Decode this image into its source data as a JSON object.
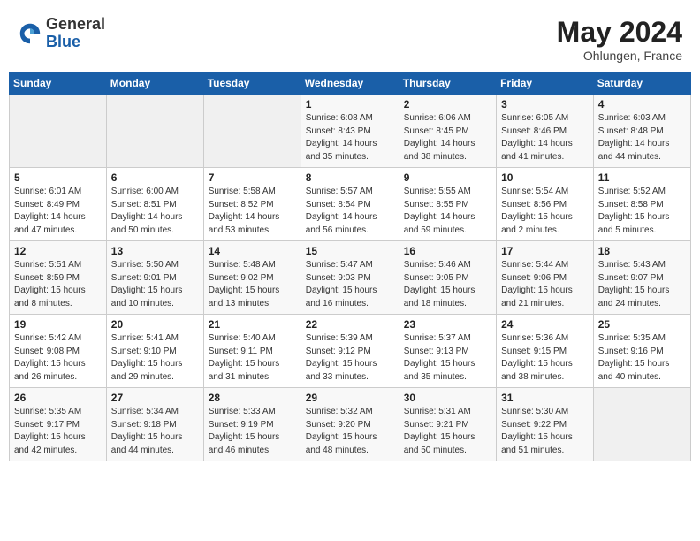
{
  "header": {
    "logo_general": "General",
    "logo_blue": "Blue",
    "month_year": "May 2024",
    "location": "Ohlungen, France"
  },
  "weekdays": [
    "Sunday",
    "Monday",
    "Tuesday",
    "Wednesday",
    "Thursday",
    "Friday",
    "Saturday"
  ],
  "weeks": [
    [
      {
        "day": "",
        "info": ""
      },
      {
        "day": "",
        "info": ""
      },
      {
        "day": "",
        "info": ""
      },
      {
        "day": "1",
        "info": "Sunrise: 6:08 AM\nSunset: 8:43 PM\nDaylight: 14 hours\nand 35 minutes."
      },
      {
        "day": "2",
        "info": "Sunrise: 6:06 AM\nSunset: 8:45 PM\nDaylight: 14 hours\nand 38 minutes."
      },
      {
        "day": "3",
        "info": "Sunrise: 6:05 AM\nSunset: 8:46 PM\nDaylight: 14 hours\nand 41 minutes."
      },
      {
        "day": "4",
        "info": "Sunrise: 6:03 AM\nSunset: 8:48 PM\nDaylight: 14 hours\nand 44 minutes."
      }
    ],
    [
      {
        "day": "5",
        "info": "Sunrise: 6:01 AM\nSunset: 8:49 PM\nDaylight: 14 hours\nand 47 minutes."
      },
      {
        "day": "6",
        "info": "Sunrise: 6:00 AM\nSunset: 8:51 PM\nDaylight: 14 hours\nand 50 minutes."
      },
      {
        "day": "7",
        "info": "Sunrise: 5:58 AM\nSunset: 8:52 PM\nDaylight: 14 hours\nand 53 minutes."
      },
      {
        "day": "8",
        "info": "Sunrise: 5:57 AM\nSunset: 8:54 PM\nDaylight: 14 hours\nand 56 minutes."
      },
      {
        "day": "9",
        "info": "Sunrise: 5:55 AM\nSunset: 8:55 PM\nDaylight: 14 hours\nand 59 minutes."
      },
      {
        "day": "10",
        "info": "Sunrise: 5:54 AM\nSunset: 8:56 PM\nDaylight: 15 hours\nand 2 minutes."
      },
      {
        "day": "11",
        "info": "Sunrise: 5:52 AM\nSunset: 8:58 PM\nDaylight: 15 hours\nand 5 minutes."
      }
    ],
    [
      {
        "day": "12",
        "info": "Sunrise: 5:51 AM\nSunset: 8:59 PM\nDaylight: 15 hours\nand 8 minutes."
      },
      {
        "day": "13",
        "info": "Sunrise: 5:50 AM\nSunset: 9:01 PM\nDaylight: 15 hours\nand 10 minutes."
      },
      {
        "day": "14",
        "info": "Sunrise: 5:48 AM\nSunset: 9:02 PM\nDaylight: 15 hours\nand 13 minutes."
      },
      {
        "day": "15",
        "info": "Sunrise: 5:47 AM\nSunset: 9:03 PM\nDaylight: 15 hours\nand 16 minutes."
      },
      {
        "day": "16",
        "info": "Sunrise: 5:46 AM\nSunset: 9:05 PM\nDaylight: 15 hours\nand 18 minutes."
      },
      {
        "day": "17",
        "info": "Sunrise: 5:44 AM\nSunset: 9:06 PM\nDaylight: 15 hours\nand 21 minutes."
      },
      {
        "day": "18",
        "info": "Sunrise: 5:43 AM\nSunset: 9:07 PM\nDaylight: 15 hours\nand 24 minutes."
      }
    ],
    [
      {
        "day": "19",
        "info": "Sunrise: 5:42 AM\nSunset: 9:08 PM\nDaylight: 15 hours\nand 26 minutes."
      },
      {
        "day": "20",
        "info": "Sunrise: 5:41 AM\nSunset: 9:10 PM\nDaylight: 15 hours\nand 29 minutes."
      },
      {
        "day": "21",
        "info": "Sunrise: 5:40 AM\nSunset: 9:11 PM\nDaylight: 15 hours\nand 31 minutes."
      },
      {
        "day": "22",
        "info": "Sunrise: 5:39 AM\nSunset: 9:12 PM\nDaylight: 15 hours\nand 33 minutes."
      },
      {
        "day": "23",
        "info": "Sunrise: 5:37 AM\nSunset: 9:13 PM\nDaylight: 15 hours\nand 35 minutes."
      },
      {
        "day": "24",
        "info": "Sunrise: 5:36 AM\nSunset: 9:15 PM\nDaylight: 15 hours\nand 38 minutes."
      },
      {
        "day": "25",
        "info": "Sunrise: 5:35 AM\nSunset: 9:16 PM\nDaylight: 15 hours\nand 40 minutes."
      }
    ],
    [
      {
        "day": "26",
        "info": "Sunrise: 5:35 AM\nSunset: 9:17 PM\nDaylight: 15 hours\nand 42 minutes."
      },
      {
        "day": "27",
        "info": "Sunrise: 5:34 AM\nSunset: 9:18 PM\nDaylight: 15 hours\nand 44 minutes."
      },
      {
        "day": "28",
        "info": "Sunrise: 5:33 AM\nSunset: 9:19 PM\nDaylight: 15 hours\nand 46 minutes."
      },
      {
        "day": "29",
        "info": "Sunrise: 5:32 AM\nSunset: 9:20 PM\nDaylight: 15 hours\nand 48 minutes."
      },
      {
        "day": "30",
        "info": "Sunrise: 5:31 AM\nSunset: 9:21 PM\nDaylight: 15 hours\nand 50 minutes."
      },
      {
        "day": "31",
        "info": "Sunrise: 5:30 AM\nSunset: 9:22 PM\nDaylight: 15 hours\nand 51 minutes."
      },
      {
        "day": "",
        "info": ""
      }
    ]
  ]
}
